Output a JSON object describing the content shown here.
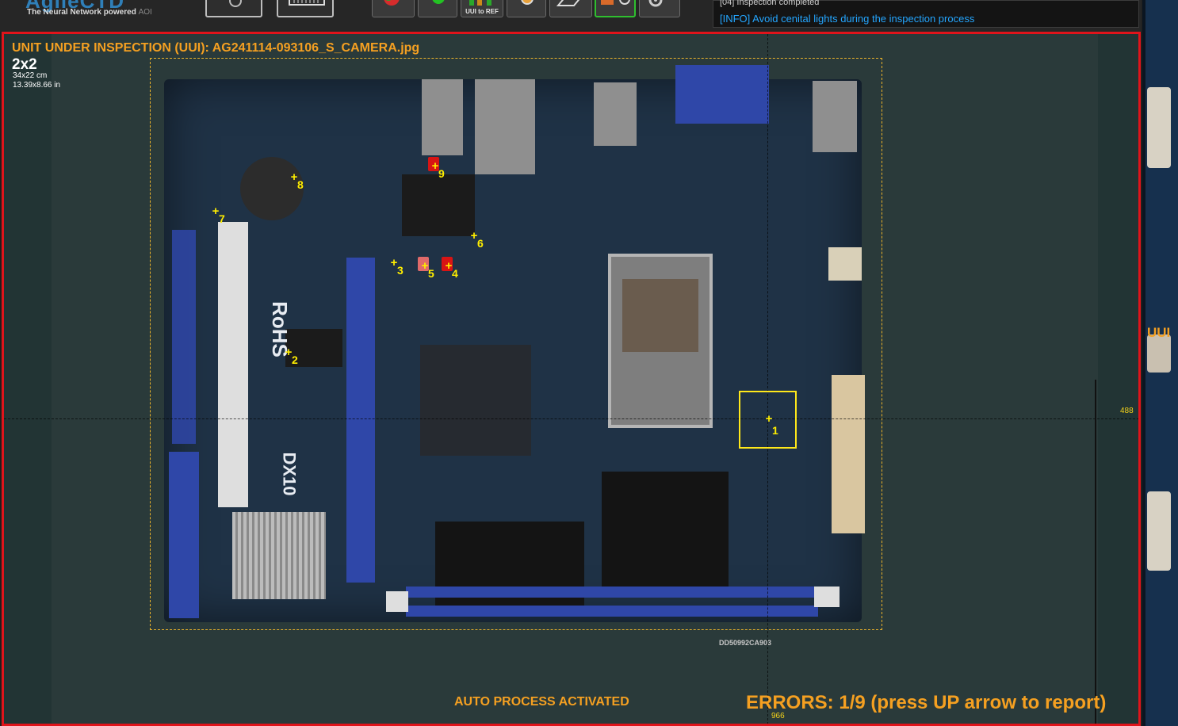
{
  "app": {
    "brand_name": "AgileCTD",
    "brand_tagline": "The Neural Network powered",
    "brand_tagline_suffix": "AOI"
  },
  "toolbar": {
    "buttons": [
      {
        "name": "search",
        "label": ""
      },
      {
        "name": "barcode",
        "label": ""
      },
      {
        "name": "stop",
        "label": ""
      },
      {
        "name": "go",
        "label": ""
      },
      {
        "name": "uui-to-ref",
        "label": "UUI to REF"
      },
      {
        "name": "capture",
        "label": ""
      },
      {
        "name": "erase",
        "label": ""
      },
      {
        "name": "inspect",
        "label": ""
      },
      {
        "name": "settings",
        "label": ""
      }
    ]
  },
  "log": {
    "line1": "[04] Inspection completed",
    "line2": "[INFO] Avoid cenital lights during the inspection process"
  },
  "viewer": {
    "title": "UNIT UNDER INSPECTION (UUI): AG241114-093106_S_CAMERA.jpg",
    "grid": "2x2",
    "size_cm": "34x22 cm",
    "size_in": "13.39x8.66 in",
    "cursor_y": "488",
    "cursor_x": "966",
    "auto_process": "AUTO PROCESS ACTIVATED",
    "errors_text": "ERRORS: 1/9 (press UP arrow to report)"
  },
  "markers": [
    {
      "id": "1",
      "state": "selected"
    },
    {
      "id": "2",
      "state": "ok"
    },
    {
      "id": "3",
      "state": "ok"
    },
    {
      "id": "4",
      "state": "error"
    },
    {
      "id": "5",
      "state": "warning"
    },
    {
      "id": "6",
      "state": "ok"
    },
    {
      "id": "7",
      "state": "ok"
    },
    {
      "id": "8",
      "state": "ok"
    },
    {
      "id": "9",
      "state": "error"
    }
  ],
  "board_silk": {
    "rohs": "RoHS",
    "model": "DX10",
    "serial": "DD50992CA903"
  },
  "side_panel": {
    "label": "UUI"
  },
  "colors": {
    "accent_orange": "#f5a021",
    "viewer_border": "#e0141b",
    "marker_yellow": "#ffee00",
    "log_info_blue": "#24a6ff"
  }
}
